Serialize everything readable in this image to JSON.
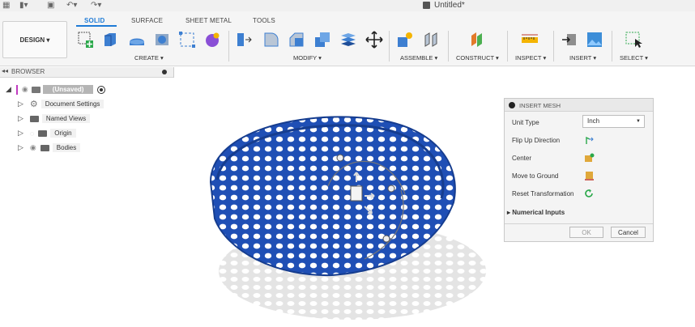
{
  "window": {
    "title": "Untitled*"
  },
  "toolbar": {
    "workspace_label": "DESIGN ▾",
    "tabs": [
      "SOLID",
      "SURFACE",
      "SHEET METAL",
      "TOOLS"
    ],
    "groups": [
      "CREATE ▾",
      "MODIFY ▾",
      "ASSEMBLE ▾",
      "CONSTRUCT ▾",
      "INSPECT ▾",
      "INSERT ▾",
      "SELECT ▾"
    ]
  },
  "browser": {
    "title": "BROWSER",
    "root": "(Unsaved)",
    "items": [
      "Document Settings",
      "Named Views",
      "Origin",
      "Bodies"
    ]
  },
  "insert_mesh": {
    "title": "INSERT MESH",
    "unit_type_label": "Unit Type",
    "unit_type_value": "Inch",
    "flip_label": "Flip Up Direction",
    "center_label": "Center",
    "move_label": "Move to Ground",
    "reset_label": "Reset Transformation",
    "numerical_label": "Numerical Inputs",
    "ok_label": "OK",
    "cancel_label": "Cancel"
  },
  "colors": {
    "accent": "#1f7bd6",
    "mesh_blue": "#1f4fb5"
  },
  "icons": [
    "grid-icon",
    "file-icon",
    "save-icon",
    "undo-icon",
    "redo-icon",
    "cube-icon",
    "eye-icon",
    "gear-icon",
    "folder-icon"
  ]
}
